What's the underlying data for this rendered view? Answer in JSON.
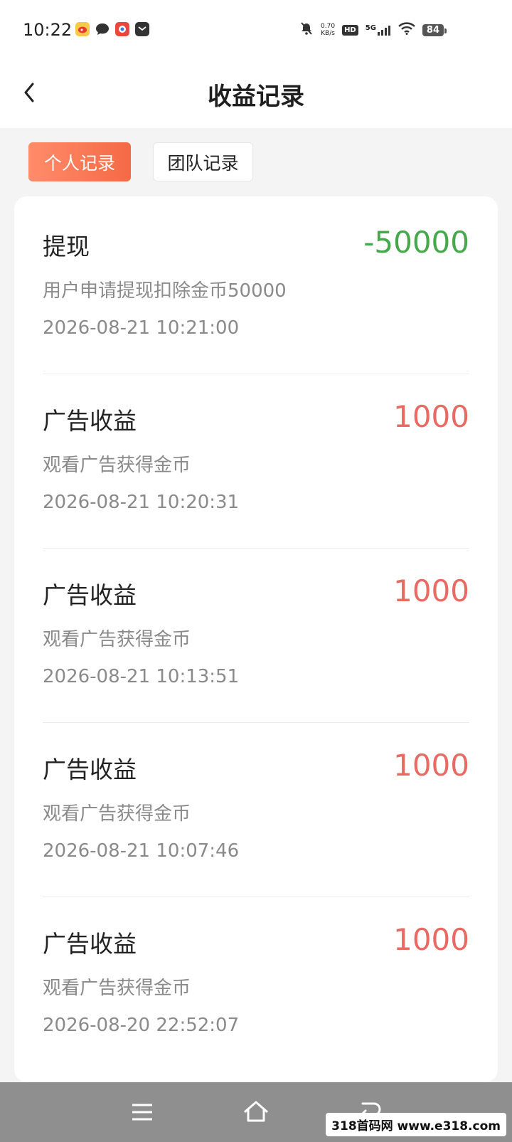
{
  "status_bar": {
    "time": "10:22",
    "net_speed": "0.70",
    "net_unit": "KB/s",
    "hd": "HD",
    "signal": "5G",
    "battery": "84"
  },
  "header": {
    "title": "收益记录"
  },
  "tabs": [
    {
      "label": "个人记录",
      "active": true
    },
    {
      "label": "团队记录",
      "active": false
    }
  ],
  "records": [
    {
      "title": "提现",
      "amount": "-50000",
      "desc": "用户申请提现扣除金币50000",
      "time": "2026-08-21 10:21:00",
      "sign": "negative"
    },
    {
      "title": "广告收益",
      "amount": "1000",
      "desc": "观看广告获得金币",
      "time": "2026-08-21 10:20:31",
      "sign": "positive"
    },
    {
      "title": "广告收益",
      "amount": "1000",
      "desc": "观看广告获得金币",
      "time": "2026-08-21 10:13:51",
      "sign": "positive"
    },
    {
      "title": "广告收益",
      "amount": "1000",
      "desc": "观看广告获得金币",
      "time": "2026-08-21 10:07:46",
      "sign": "positive"
    },
    {
      "title": "广告收益",
      "amount": "1000",
      "desc": "观看广告获得金币",
      "time": "2026-08-20 22:52:07",
      "sign": "positive"
    }
  ],
  "colors": {
    "accent": "#f46a45",
    "negative": "#45a84a",
    "positive": "#e86a63"
  },
  "watermark": "318首码网 www.e318.com"
}
